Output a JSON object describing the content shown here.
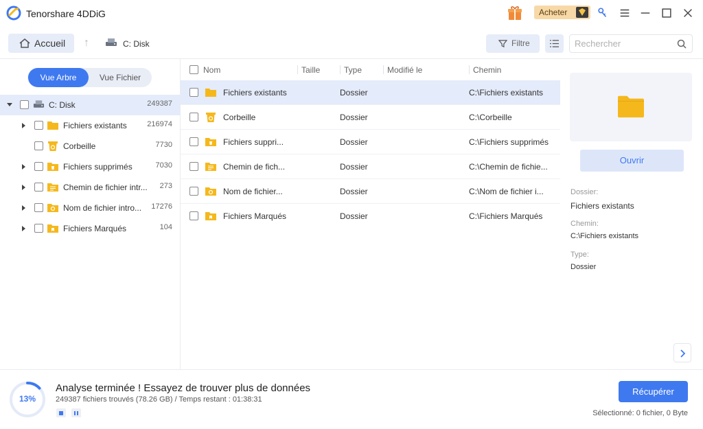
{
  "app": {
    "title": "Tenorshare 4DDiG",
    "buy_label": "Acheter"
  },
  "toolbar": {
    "home_label": "Accueil",
    "path_label": "C: Disk",
    "filter_label": "Filtre",
    "search_placeholder": "Rechercher"
  },
  "sidebar": {
    "view_tree_label": "Vue Arbre",
    "view_file_label": "Vue Fichier",
    "root": {
      "label": "C: Disk",
      "count": "249387"
    },
    "items": [
      {
        "label": "Fichiers existants",
        "count": "216974",
        "icon": "folder-icon"
      },
      {
        "label": "Corbeille",
        "count": "7730",
        "icon": "recycle-bin-icon"
      },
      {
        "label": "Fichiers supprimés",
        "count": "7030",
        "icon": "deleted-files-icon"
      },
      {
        "label": "Chemin de fichier intr...",
        "count": "273",
        "icon": "lost-path-icon"
      },
      {
        "label": "Nom de fichier intro...",
        "count": "17276",
        "icon": "lost-name-icon"
      },
      {
        "label": "Fichiers Marqués",
        "count": "104",
        "icon": "tagged-files-icon"
      }
    ]
  },
  "table": {
    "columns": [
      "Nom",
      "Taille",
      "Type",
      "Modifié le",
      "Chemin"
    ],
    "rows": [
      {
        "name": "Fichiers existants",
        "size": "",
        "type": "Dossier",
        "modified": "",
        "path": "C:\\Fichiers existants"
      },
      {
        "name": "Corbeille",
        "size": "",
        "type": "Dossier",
        "modified": "",
        "path": "C:\\Corbeille"
      },
      {
        "name": "Fichiers suppri...",
        "size": "",
        "type": "Dossier",
        "modified": "",
        "path": "C:\\Fichiers supprimés"
      },
      {
        "name": "Chemin de fich...",
        "size": "",
        "type": "Dossier",
        "modified": "",
        "path": "C:\\Chemin de fichie..."
      },
      {
        "name": "Nom de fichier...",
        "size": "",
        "type": "Dossier",
        "modified": "",
        "path": "C:\\Nom de fichier i..."
      },
      {
        "name": "Fichiers Marqués",
        "size": "",
        "type": "Dossier",
        "modified": "",
        "path": "C:\\Fichiers Marqués"
      }
    ]
  },
  "details": {
    "open_label": "Ouvrir",
    "folder_label": "Dossier:",
    "folder_value": "Fichiers existants",
    "path_label": "Chemin:",
    "path_value": "C:\\Fichiers existants",
    "type_label": "Type:",
    "type_value": "Dossier"
  },
  "status": {
    "progress_percent": 13,
    "progress_label": "13%",
    "title": "Analyse terminée ! Essayez de trouver plus de données",
    "subtitle": "249387 fichiers trouvés (78.26 GB) /  Temps restant : 01:38:31",
    "recover_label": "Récupérer",
    "selected_info": "Sélectionné: 0 fichier, 0 Byte"
  },
  "colors": {
    "accent": "#3f79f0",
    "folder": "#f5b81c",
    "selection": "#e4ebfa"
  }
}
